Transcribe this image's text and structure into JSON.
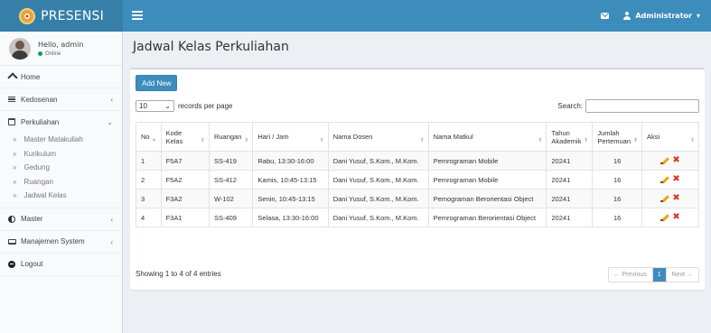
{
  "app": {
    "brand": "PRESENSI"
  },
  "topbar": {
    "user": "Administrator",
    "caret": "▾"
  },
  "user_panel": {
    "hello": "Hello, admin",
    "status": "Online"
  },
  "sidebar": {
    "home": "Home",
    "kedosenan": "Kedosenan",
    "perkuliahan": "Perkuliahan",
    "submenu": [
      "Master Matakuliah",
      "Kurikulum",
      "Gedung",
      "Ruangan",
      "Jadwal Kelas"
    ],
    "master": "Master",
    "manajemen": "Manajemen System",
    "logout": "Logout"
  },
  "page": {
    "title": "Jadwal Kelas Perkuliahan"
  },
  "box": {
    "add_label": "Add New",
    "length_value": "10",
    "length_suffix": "records per page",
    "search_label": "Search:",
    "search_value": ""
  },
  "table": {
    "headers": [
      "No",
      "Kode Kelas",
      "Ruangan",
      "Hari / Jam",
      "Nama Dosen",
      "Nama Matkul",
      "Tahun Akademik",
      "Jumlah Pertemuan",
      "Aksi"
    ],
    "rows": [
      [
        "1",
        "F5A7",
        "SS-419",
        "Rabu, 13:30-16:00",
        "Dani Yusuf, S.Kom., M.Kom.",
        "Pemrograman Mobile",
        "20241",
        "16"
      ],
      [
        "2",
        "F5A2",
        "SS-412",
        "Kamis, 10:45-13:15",
        "Dani Yusuf, S.Kom., M.Kom.",
        "Pemrograman Mobile",
        "20241",
        "16"
      ],
      [
        "3",
        "F3A2",
        "W-102",
        "Senin, 10:45-13:15",
        "Dani Yusuf, S.Kom., M.Kom.",
        "Pemograman Berorientasi Object",
        "20241",
        "16"
      ],
      [
        "4",
        "F3A1",
        "SS-409",
        "Selasa, 13:30-16:00",
        "Dani Yusuf, S.Kom., M.Kom.",
        "Pemrograman Berorientasi Object",
        "20241",
        "16"
      ]
    ]
  },
  "footer": {
    "info": "Showing 1 to 4 of 4 entries",
    "previous": "← Previous",
    "page": "1",
    "next": "Next →"
  },
  "colors": {
    "header": "#3c8dbc",
    "brand_bg": "#367fa9",
    "online": "#00a65a",
    "delete": "#d73925"
  }
}
